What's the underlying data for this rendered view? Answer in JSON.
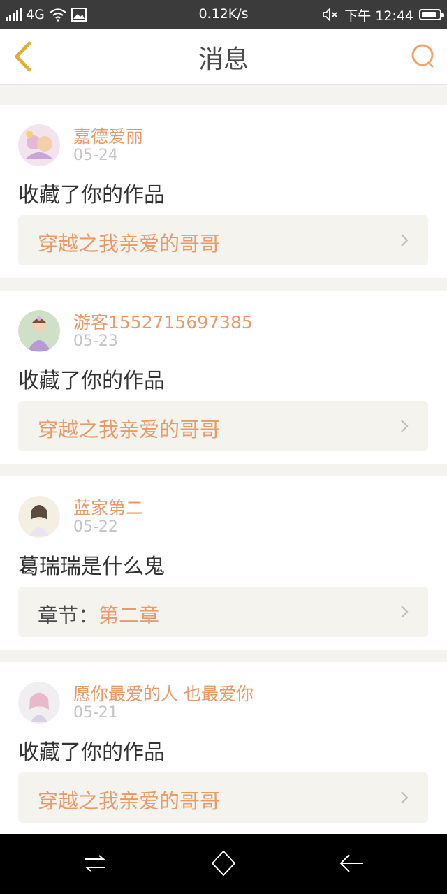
{
  "status_bar": {
    "network": "4G",
    "speed": "0.12K/s",
    "time": "下午 12:44",
    "battery_level": 0.85
  },
  "header": {
    "title": "消息",
    "back_icon": "chevron-left-icon",
    "search_icon": "search-icon"
  },
  "colors": {
    "accent": "#ea9a68",
    "username": "#e79a67",
    "back_icon": "#e1b43b",
    "search_icon": "#f0a36b",
    "date": "#c4c4c4",
    "card_link_bg": "#f4f3ee"
  },
  "messages": [
    {
      "username": "嘉德爱丽",
      "date": "05-24",
      "text": "收藏了你的作品",
      "link_prefix": "",
      "link_text": "穿越之我亲爱的哥哥"
    },
    {
      "username": "游客1552715697385",
      "date": "05-23",
      "text": "收藏了你的作品",
      "link_prefix": "",
      "link_text": "穿越之我亲爱的哥哥"
    },
    {
      "username": "蓝家第二",
      "date": "05-22",
      "text": "葛瑞瑞是什么鬼",
      "link_prefix": "章节：",
      "link_text": "第二章"
    },
    {
      "username": "愿你最爱的人 也最爱你",
      "date": "05-21",
      "text": "收藏了你的作品",
      "link_prefix": "",
      "link_text": "穿越之我亲爱的哥哥"
    }
  ],
  "nav_bar": {
    "buttons": [
      "menu-switch-icon",
      "home-icon",
      "back-arrow-icon"
    ]
  }
}
